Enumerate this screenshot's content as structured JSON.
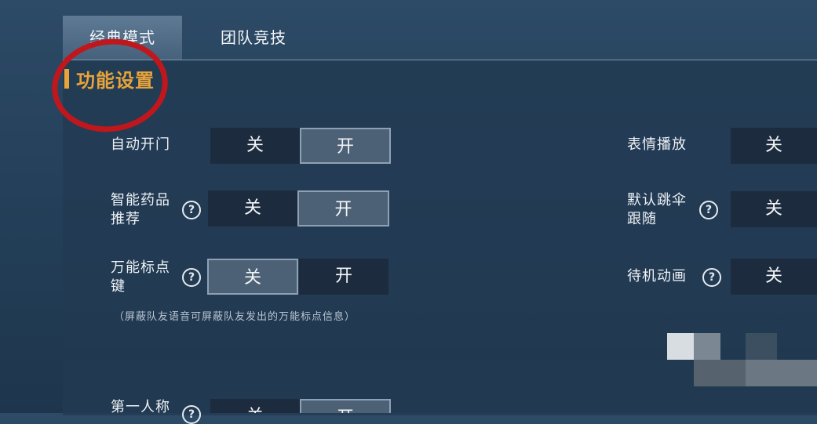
{
  "tabs": [
    {
      "label": "经典模式",
      "active": true
    },
    {
      "label": "团队竞技",
      "active": false
    }
  ],
  "section": {
    "title": "功能设置"
  },
  "settings": {
    "auto_door": {
      "label": "自动开门",
      "off": "关",
      "on": "开",
      "selected": "开"
    },
    "smart_medicine": {
      "label_line1": "智能药品",
      "label_line2": "推荐",
      "off": "关",
      "on": "开",
      "selected": "开"
    },
    "universal_marker": {
      "label_line1": "万能标点",
      "label_line2": "键",
      "off": "关",
      "on": "开",
      "selected": "关"
    },
    "marker_note": "（屏蔽队友语音可屏蔽队友发出的万能标点信息）",
    "emote_play": {
      "label": "表情播放",
      "off": "关"
    },
    "default_parachute": {
      "label_line1": "默认跳伞",
      "label_line2": "跟随",
      "off": "关"
    },
    "idle_anim": {
      "label": "待机动画",
      "off": "关"
    },
    "first_person": {
      "label": "第一人称",
      "off": "关",
      "on": "开"
    }
  },
  "help_glyph": "?",
  "colors": {
    "accent": "#e8a33a",
    "annotation": "#c0171d"
  }
}
